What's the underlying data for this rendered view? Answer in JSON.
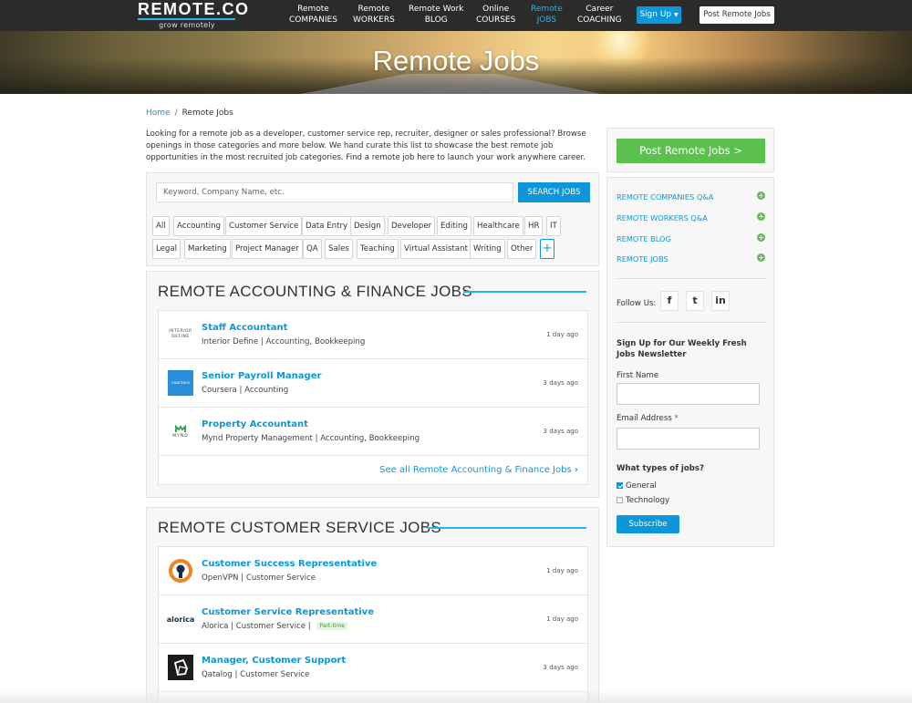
{
  "brand": {
    "logo": "REMOTE.CO",
    "tagline": "grow remotely"
  },
  "nav": {
    "items": [
      {
        "line1": "Remote",
        "line2": "COMPANIES"
      },
      {
        "line1": "Remote",
        "line2": "WORKERS"
      },
      {
        "line1": "Remote Work",
        "line2": "BLOG"
      },
      {
        "line1": "Online",
        "line2": "COURSES"
      },
      {
        "line1": "Remote",
        "line2": "JOBS"
      },
      {
        "line1": "Career",
        "line2": "COACHING"
      }
    ],
    "signup_label": "Sign Up",
    "post_jobs_label": "Post Remote Jobs"
  },
  "hero": {
    "title": "Remote Jobs"
  },
  "breadcrumb": {
    "home": "Home",
    "separator": "/",
    "current": "Remote Jobs"
  },
  "intro": "Looking for a remote job as a developer, customer service rep, recruiter, designer or sales professional? Browse openings in those categories and more below. We hand curate this list to showcase the best remote job opportunities in the most recruited job categories. Find a remote job here to launch your work anywhere career.",
  "search": {
    "placeholder": "Keyword, Company Name, etc.",
    "button_label": "SEARCH JOBS",
    "tags_row1": [
      "All",
      "Accounting",
      "Customer Service",
      "Data Entry",
      "Design",
      "Developer",
      "Editing",
      "Healthcare",
      "HR",
      "IT"
    ],
    "tags_row2": [
      "Legal",
      "Marketing",
      "Project Manager",
      "QA",
      "Sales",
      "Teaching",
      "Virtual Assistant",
      "Writing",
      "Other"
    ],
    "more_label": "+"
  },
  "sections": [
    {
      "title": "REMOTE ACCOUNTING & FINANCE JOBS",
      "jobs": [
        {
          "title": "Staff Accountant",
          "company": "Interior Define",
          "categories": "Accounting, Bookkeeping",
          "age": "1 day ago",
          "logo_text": "INTERIOR DEFINE"
        },
        {
          "title": "Senior Payroll Manager",
          "company": "Coursera",
          "categories": "Accounting",
          "age": "3 days ago",
          "logo_text": "coursera"
        },
        {
          "title": "Property Accountant",
          "company": "Mynd Property Management",
          "categories": "Accounting, Bookkeeping",
          "age": "3 days ago",
          "logo_text": "MYND"
        }
      ],
      "see_all": "See all Remote Accounting & Finance Jobs"
    },
    {
      "title": "REMOTE CUSTOMER SERVICE JOBS",
      "jobs": [
        {
          "title": "Customer Success Representative",
          "company": "OpenVPN",
          "categories": "Customer Service",
          "age": "1 day ago"
        },
        {
          "title": "Customer Service Representative",
          "company": "Alorica",
          "categories": "Customer Service",
          "badge": "Part-time",
          "age": "1 day ago",
          "logo_text": "alorica"
        },
        {
          "title": "Manager, Customer Support",
          "company": "Qatalog",
          "categories": "Customer Service",
          "age": "3 days ago"
        }
      ]
    }
  ],
  "sidebar": {
    "post_button": "Post Remote Jobs >",
    "links": [
      "REMOTE COMPANIES Q&A",
      "REMOTE WORKERS Q&A",
      "REMOTE BLOG",
      "REMOTE JOBS"
    ],
    "follow_label": "Follow Us:",
    "social": [
      "f",
      "t",
      "in"
    ],
    "newsletter_heading": "Sign Up for Our Weekly Fresh Jobs Newsletter",
    "first_name_label": "First Name",
    "email_label": "Email Address",
    "required_mark": "*",
    "job_types_label": "What types of jobs?",
    "job_types": [
      {
        "label": "General",
        "checked": true
      },
      {
        "label": "Technology",
        "checked": false
      }
    ],
    "subscribe_label": "Subscribe"
  },
  "colors": {
    "accent": "#0d96d9",
    "green": "#5cc04f",
    "dark_bar": "#2b2b2b"
  }
}
